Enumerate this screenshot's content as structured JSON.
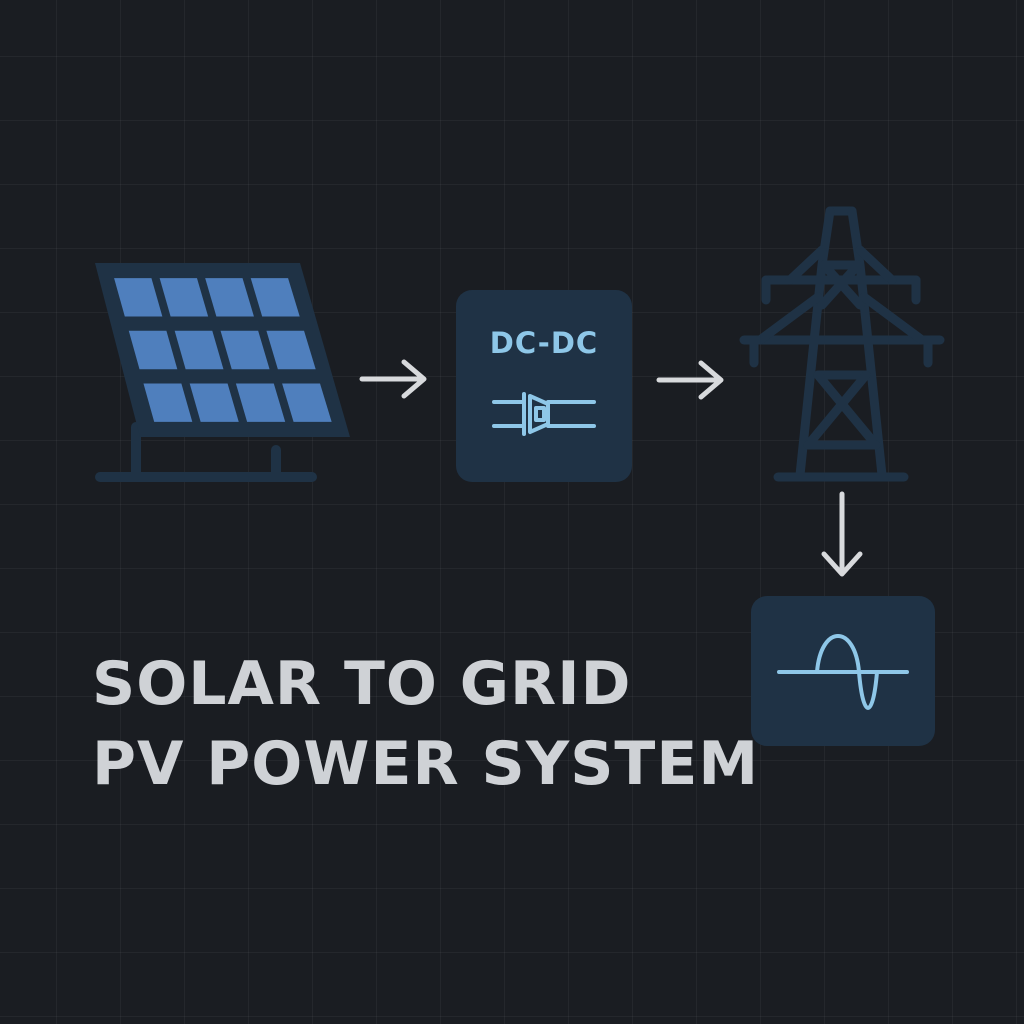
{
  "colors": {
    "background": "#1a1d22",
    "panel_cell": "#4f7fbd",
    "icon_stroke": "#1f3245",
    "box_fill": "#1f3245",
    "accent": "#8ec7e8",
    "arrow": "#d8dadd",
    "title_text": "#cfd2d6"
  },
  "nodes": {
    "solar_panel": {
      "icon": "solar-panel-icon"
    },
    "converter": {
      "label": "DC-DC",
      "icon": "converter-symbol-icon"
    },
    "grid_tower": {
      "icon": "transmission-tower-icon"
    },
    "inverter": {
      "icon": "sine-wave-icon"
    }
  },
  "edges": [
    {
      "from": "solar_panel",
      "to": "converter",
      "icon": "arrow-right-icon"
    },
    {
      "from": "converter",
      "to": "grid_tower",
      "icon": "arrow-right-icon"
    },
    {
      "from": "grid_tower",
      "to": "inverter",
      "icon": "arrow-down-icon"
    }
  ],
  "title": {
    "line1": "SOLAR TO GRID",
    "line2": "PV POWER SYSTEM"
  }
}
